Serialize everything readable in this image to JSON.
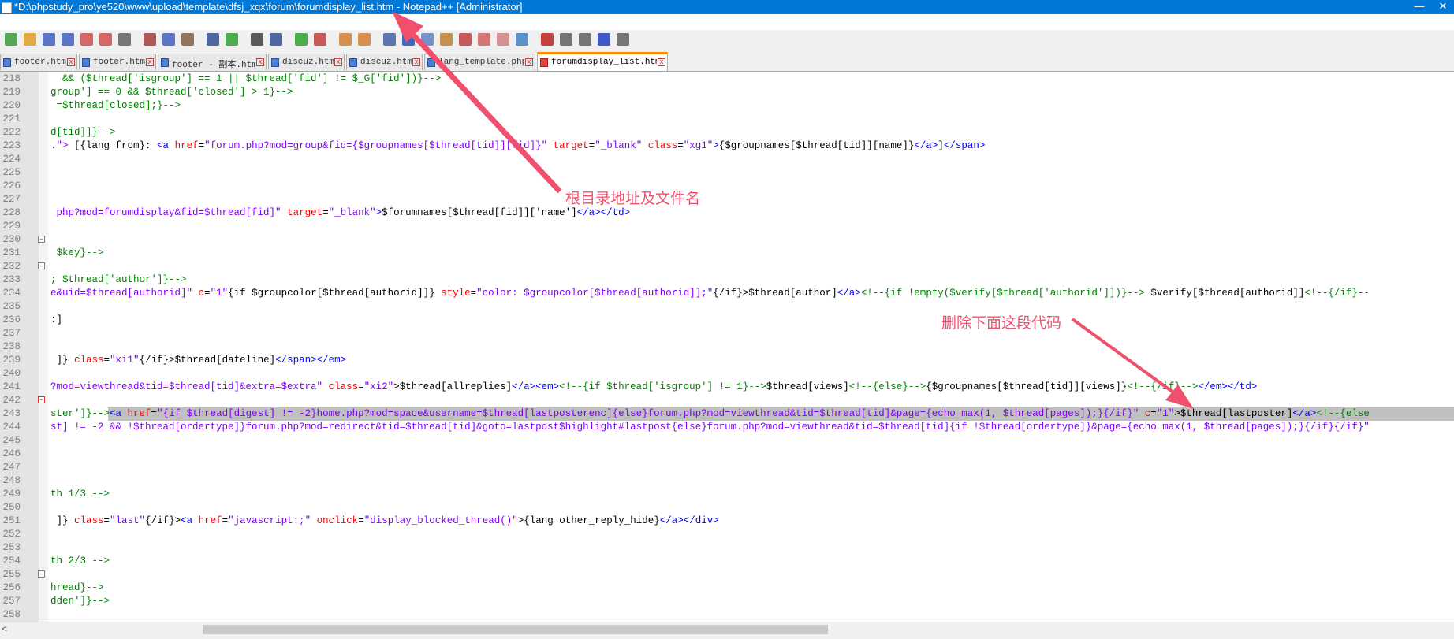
{
  "window": {
    "title": "*D:\\phpstudy_pro\\ye520\\www\\upload\\template\\dfsj_xqx\\forum\\forumdisplay_list.htm - Notepad++ [Administrator]",
    "minimize_glyph": "—",
    "close_glyph": "✕"
  },
  "tabs": [
    {
      "label": "footer.htm",
      "active": false
    },
    {
      "label": "footer.htm",
      "active": false
    },
    {
      "label": "footer - 副本.htm",
      "active": false
    },
    {
      "label": "discuz.htm",
      "active": false
    },
    {
      "label": "discuz.htm",
      "active": false
    },
    {
      "label": "lang_template.php",
      "active": false
    },
    {
      "label": "forumdisplay_list.htm",
      "active": true
    }
  ],
  "tab_close_glyph": "x",
  "toolbar_icons": [
    "new-file-icon",
    "open-file-icon",
    "save-icon",
    "save-all-icon",
    "close-icon",
    "close-all-icon",
    "print-icon",
    "cut-icon",
    "copy-icon",
    "paste-icon",
    "undo-icon",
    "redo-icon",
    "find-icon",
    "replace-icon",
    "zoom-in-icon",
    "zoom-out-icon",
    "sync-vertical-icon",
    "sync-horizontal-icon",
    "word-wrap-icon",
    "show-all-chars-icon",
    "indent-guide-icon",
    "udl-icon",
    "doc-map-icon",
    "function-list-icon",
    "folder-workspace-icon",
    "monitor-icon",
    "record-macro-icon",
    "stop-macro-icon",
    "play-macro-icon",
    "run-macro-multiple-icon",
    "save-macro-icon"
  ],
  "editor": {
    "lines": [
      {
        "num": "218",
        "segs": [
          {
            "t": "  && ($thread['isgroup'] == 1 || $thread['fid'] != $_G['fid'])}-->",
            "c": "comment"
          }
        ]
      },
      {
        "num": "219",
        "segs": [
          {
            "t": "group'] == 0 && $thread['closed'] > 1}-->",
            "c": "comment"
          }
        ]
      },
      {
        "num": "220",
        "segs": [
          {
            "t": " =$thread[closed];}-->",
            "c": "comment"
          }
        ]
      },
      {
        "num": "221",
        "segs": []
      },
      {
        "num": "222",
        "segs": [
          {
            "t": "d[tid]]}-->",
            "c": "comment"
          }
        ]
      },
      {
        "num": "223",
        "segs": [
          {
            "t": ".\"> ",
            "c": "value"
          },
          {
            "t": "[{lang from}: ",
            "c": "text"
          },
          {
            "t": "<a ",
            "c": "tag"
          },
          {
            "t": "href",
            "c": "attr"
          },
          {
            "t": "=",
            "c": "text"
          },
          {
            "t": "\"forum.php?mod=group&fid={$groupnames[$thread[tid]][fid]}\"",
            "c": "value"
          },
          {
            "t": " target",
            "c": "attr"
          },
          {
            "t": "=",
            "c": "text"
          },
          {
            "t": "\"_blank\"",
            "c": "value"
          },
          {
            "t": " class",
            "c": "attr"
          },
          {
            "t": "=",
            "c": "text"
          },
          {
            "t": "\"xg1\"",
            "c": "value"
          },
          {
            "t": ">",
            "c": "tag"
          },
          {
            "t": "{$groupnames[$thread[tid]][name]}",
            "c": "text"
          },
          {
            "t": "</a>",
            "c": "tag"
          },
          {
            "t": "]",
            "c": "text"
          },
          {
            "t": "</span>",
            "c": "tag"
          }
        ]
      },
      {
        "num": "224",
        "segs": []
      },
      {
        "num": "225",
        "segs": []
      },
      {
        "num": "226",
        "segs": []
      },
      {
        "num": "227",
        "segs": []
      },
      {
        "num": "228",
        "segs": [
          {
            "t": " php?mod=forumdisplay&fid=$thread[fid]\"",
            "c": "value"
          },
          {
            "t": " target",
            "c": "attr"
          },
          {
            "t": "=",
            "c": "text"
          },
          {
            "t": "\"_blank\"",
            "c": "value"
          },
          {
            "t": ">",
            "c": "tag"
          },
          {
            "t": "$forumnames[$thread[fid]]['name']",
            "c": "text"
          },
          {
            "t": "</a></td>",
            "c": "tag"
          }
        ]
      },
      {
        "num": "229",
        "segs": []
      },
      {
        "num": "230",
        "segs": []
      },
      {
        "num": "231",
        "segs": [
          {
            "t": " $key}-->",
            "c": "comment"
          }
        ]
      },
      {
        "num": "232",
        "segs": []
      },
      {
        "num": "233",
        "segs": [
          {
            "t": "; $thread['author']}-->",
            "c": "comment"
          }
        ]
      },
      {
        "num": "234",
        "segs": [
          {
            "t": "e&uid=$thread[authorid]\"",
            "c": "value"
          },
          {
            "t": " c",
            "c": "attr"
          },
          {
            "t": "=",
            "c": "text"
          },
          {
            "t": "\"1\"",
            "c": "value"
          },
          {
            "t": "{if $groupcolor[$thread[authorid]]} ",
            "c": "text"
          },
          {
            "t": "style",
            "c": "attr"
          },
          {
            "t": "=",
            "c": "text"
          },
          {
            "t": "\"color: $groupcolor[$thread[authorid]];\"",
            "c": "value"
          },
          {
            "t": "{/if}>$thread[author]",
            "c": "text"
          },
          {
            "t": "</a>",
            "c": "tag"
          },
          {
            "t": "<!--{if !empty($verify[$thread['authorid']])}-->",
            "c": "comment"
          },
          {
            "t": " $verify[$thread[authorid]]",
            "c": "text"
          },
          {
            "t": "<!--{/if}--",
            "c": "comment"
          }
        ]
      },
      {
        "num": "235",
        "segs": []
      },
      {
        "num": "236",
        "segs": [
          {
            "t": ":]",
            "c": "text"
          }
        ]
      },
      {
        "num": "237",
        "segs": []
      },
      {
        "num": "238",
        "segs": []
      },
      {
        "num": "239",
        "segs": [
          {
            "t": " ]} ",
            "c": "text"
          },
          {
            "t": "class",
            "c": "attr"
          },
          {
            "t": "=",
            "c": "text"
          },
          {
            "t": "\"xi1\"",
            "c": "value"
          },
          {
            "t": "{/if}>$thread[dateline]",
            "c": "text"
          },
          {
            "t": "</span></em>",
            "c": "tag"
          }
        ]
      },
      {
        "num": "240",
        "segs": []
      },
      {
        "num": "241",
        "segs": [
          {
            "t": "?mod=viewthread&tid=$thread[tid]&extra=$extra\"",
            "c": "value"
          },
          {
            "t": " class",
            "c": "attr"
          },
          {
            "t": "=",
            "c": "text"
          },
          {
            "t": "\"xi2\"",
            "c": "value"
          },
          {
            "t": ">$thread[allreplies]",
            "c": "text"
          },
          {
            "t": "</a><em>",
            "c": "tag"
          },
          {
            "t": "<!--{if $thread['isgroup'] != 1}-->",
            "c": "comment"
          },
          {
            "t": "$thread[views]",
            "c": "text"
          },
          {
            "t": "<!--{else}-->",
            "c": "comment"
          },
          {
            "t": "{$groupnames[$thread[tid]][views]}",
            "c": "text"
          },
          {
            "t": "<!--{/if}-->",
            "c": "comment"
          },
          {
            "t": "</em></td>",
            "c": "tag"
          }
        ]
      },
      {
        "num": "242",
        "segs": []
      },
      {
        "num": "243",
        "segs": [
          {
            "t": "ster']}-->",
            "c": "comment"
          },
          {
            "t": "<a ",
            "c": "tag"
          },
          {
            "t": "href",
            "c": "attr"
          },
          {
            "t": "=",
            "c": "text"
          },
          {
            "t": "\"{if $thread[digest] != -2}home.php?mod=space&username=$thread[lastposterenc]{else}forum.php?mod=viewthread&tid=$thread[tid]&page={echo max(1, $thread[pages]);}{/if}\"",
            "c": "value"
          },
          {
            "t": " c",
            "c": "attr"
          },
          {
            "t": "=",
            "c": "text"
          },
          {
            "t": "\"1\"",
            "c": "value"
          },
          {
            "t": ">$thread[lastposter]",
            "c": "text"
          },
          {
            "t": "</a>",
            "c": "tag"
          },
          {
            "t": "<!--{else",
            "c": "comment"
          }
        ]
      },
      {
        "num": "244",
        "segs": [
          {
            "t": "st] != -2 && !$thread[ordertype]}forum.php?mod=redirect&tid=$thread[tid]&goto=lastpost$highlight#lastpost{else}forum.php?mod=viewthread&tid=$thread[tid]{if !$thread[ordertype]}&page={echo max(1, $thread[pages]);}{/if}{/if}\"",
            "c": "value"
          }
        ]
      },
      {
        "num": "245",
        "segs": []
      },
      {
        "num": "246",
        "segs": []
      },
      {
        "num": "247",
        "segs": []
      },
      {
        "num": "248",
        "segs": []
      },
      {
        "num": "249",
        "segs": [
          {
            "t": "th 1/3 -->",
            "c": "comment"
          }
        ]
      },
      {
        "num": "250",
        "segs": []
      },
      {
        "num": "251",
        "segs": [
          {
            "t": " ]} ",
            "c": "text"
          },
          {
            "t": "class",
            "c": "attr"
          },
          {
            "t": "=",
            "c": "text"
          },
          {
            "t": "\"last\"",
            "c": "value"
          },
          {
            "t": "{/if}>",
            "c": "text"
          },
          {
            "t": "<a ",
            "c": "tag"
          },
          {
            "t": "href",
            "c": "attr"
          },
          {
            "t": "=",
            "c": "text"
          },
          {
            "t": "\"javascript:;\"",
            "c": "value"
          },
          {
            "t": " onclick",
            "c": "attr"
          },
          {
            "t": "=",
            "c": "text"
          },
          {
            "t": "\"display_blocked_thread()\"",
            "c": "value"
          },
          {
            "t": ">{lang other_reply_hide}",
            "c": "text"
          },
          {
            "t": "</a></div>",
            "c": "tag"
          }
        ]
      },
      {
        "num": "252",
        "segs": []
      },
      {
        "num": "253",
        "segs": []
      },
      {
        "num": "254",
        "segs": [
          {
            "t": "th 2/3 -->",
            "c": "comment"
          }
        ]
      },
      {
        "num": "255",
        "segs": []
      },
      {
        "num": "256",
        "segs": [
          {
            "t": "hread}-->",
            "c": "comment"
          }
        ]
      },
      {
        "num": "257",
        "segs": [
          {
            "t": "dden']}-->",
            "c": "comment"
          }
        ]
      },
      {
        "num": "258",
        "segs": []
      }
    ]
  },
  "annotations": {
    "root_path_note": "根目录地址及文件名",
    "delete_note": "删除下面这段代码",
    "arrow_color": "#f0506e"
  },
  "scrollbar": {
    "left_arrow": "<"
  }
}
